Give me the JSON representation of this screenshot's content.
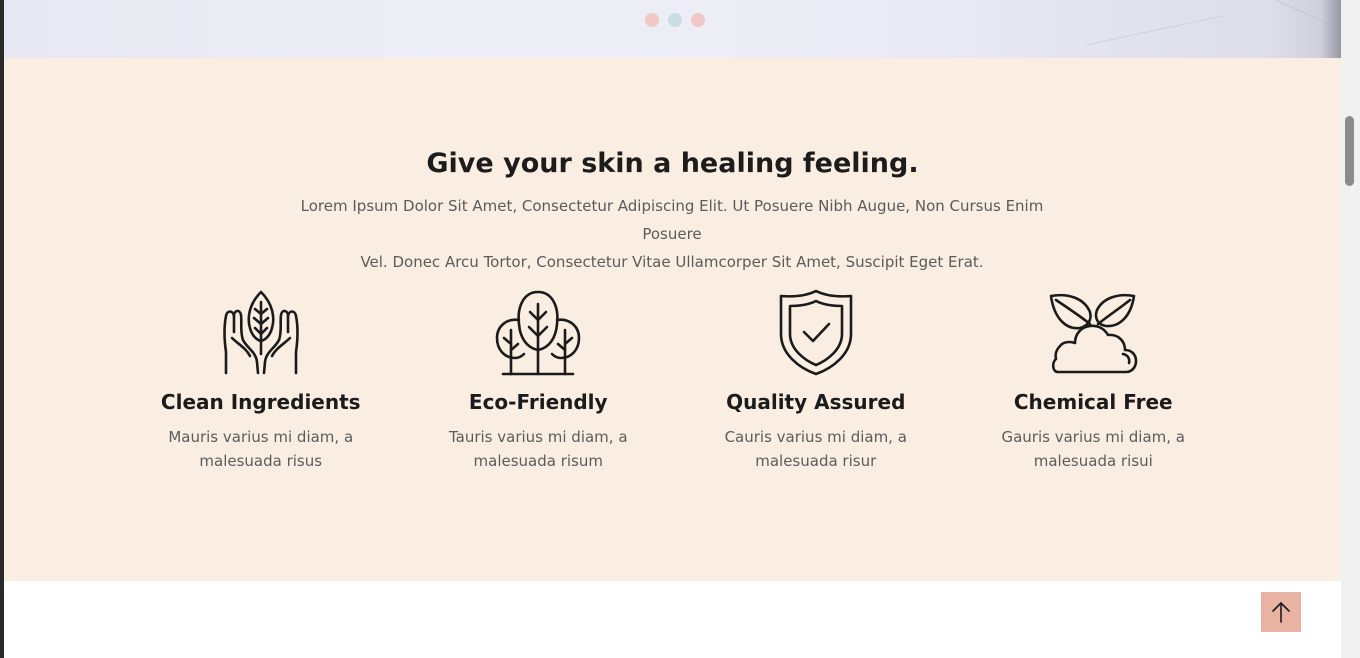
{
  "slider": {
    "dots": [
      {
        "color": "#f0c9c6"
      },
      {
        "color": "#c9dde4"
      },
      {
        "color": "#f0c9c6"
      }
    ]
  },
  "features": {
    "background": "#faeee3",
    "heading": "Give your skin a healing feeling.",
    "intro_line1": "Lorem Ipsum Dolor Sit Amet, Consectetur Adipiscing Elit. Ut Posuere Nibh Augue, Non Cursus Enim Posuere",
    "intro_line2": "Vel. Donec Arcu Tortor, Consectetur Vitae Ullamcorper Sit Amet, Suscipit Eget Erat.",
    "items": [
      {
        "icon": "hands-leaf-icon",
        "title": "Clean Ingredients",
        "desc": "Mauris varius mi diam, a malesuada risus"
      },
      {
        "icon": "trees-icon",
        "title": "Eco-Friendly",
        "desc": "Tauris varius mi diam, a malesuada risum"
      },
      {
        "icon": "shield-check-icon",
        "title": "Quality Assured",
        "desc": "Cauris varius mi diam, a malesuada risur"
      },
      {
        "icon": "cloud-leaves-icon",
        "title": "Chemical Free",
        "desc": "Gauris varius mi diam, a malesuada risui"
      }
    ]
  },
  "back_to_top": {
    "icon": "arrow-up-icon",
    "color": "#e8b3a3"
  }
}
